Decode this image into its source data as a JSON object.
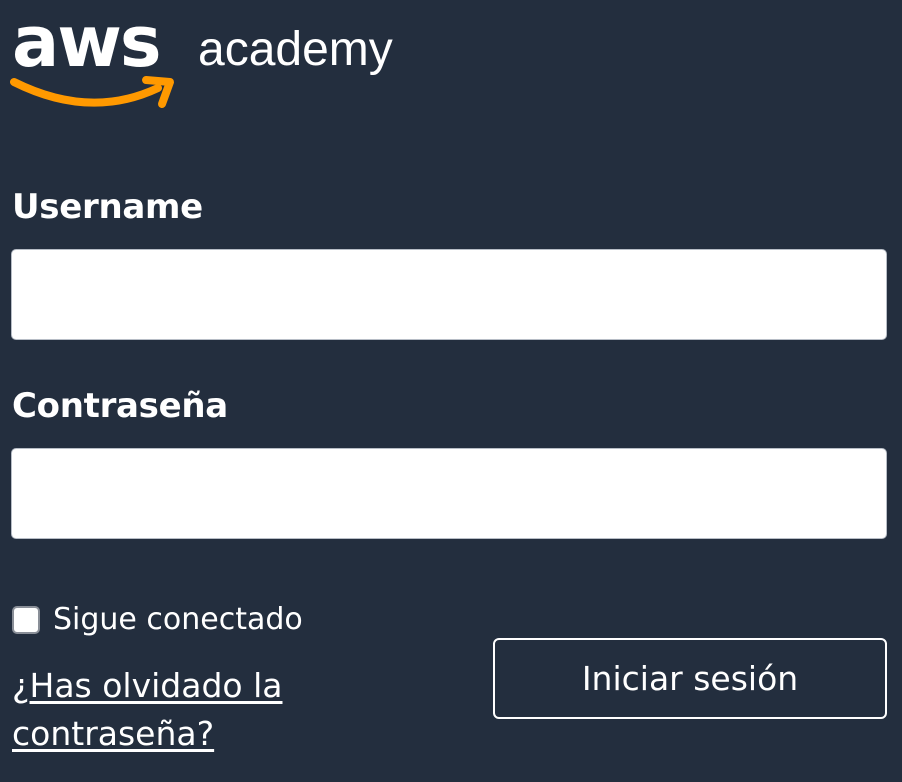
{
  "logo": {
    "mark": "aws",
    "product": "academy",
    "smile_color": "#ff9900",
    "text_color": "#ffffff"
  },
  "form": {
    "username_label": "Username",
    "username_value": "",
    "username_placeholder": "",
    "password_label": "Contraseña",
    "password_value": "",
    "password_placeholder": "",
    "remember_label": "Sigue conectado",
    "remember_checked": false,
    "forgot_prefix": "¿",
    "forgot_link": "Has olvidado la contraseña?",
    "submit_label": "Iniciar sesión"
  },
  "colors": {
    "background": "#232e3e",
    "input_background": "#ffffff",
    "text": "#ffffff"
  }
}
